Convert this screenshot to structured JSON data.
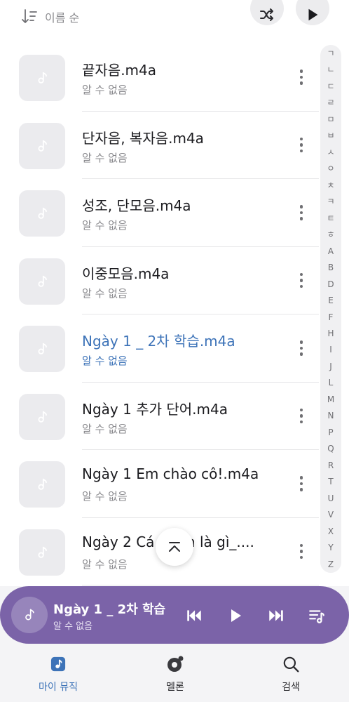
{
  "topbar": {
    "sort_label": "이름 순",
    "sort_icon": "sort-icon",
    "shuffle_icon": "shuffle-icon",
    "play_icon": "play-icon"
  },
  "songs": [
    {
      "title": "끝자음.m4a",
      "artist": "알 수 없음"
    },
    {
      "title": "단자음, 복자음.m4a",
      "artist": "알 수 없음"
    },
    {
      "title": "성조, 단모음.m4a",
      "artist": "알 수 없음"
    },
    {
      "title": "이중모음.m4a",
      "artist": "알 수 없음"
    },
    {
      "title": "Ngày 1 _ 2차 학습.m4a",
      "artist": "알 수 없음",
      "active": true
    },
    {
      "title": "Ngày 1 추가 단어.m4a",
      "artist": "알 수 없음"
    },
    {
      "title": "Ngày 1 Em chào cô!.m4a",
      "artist": "알 수 없음"
    },
    {
      "title": "Ngày 2 Cá    n tên là gì_....",
      "artist": "알 수 없음"
    }
  ],
  "index_letters": [
    "ㄱ",
    "ㄴ",
    "ㄷ",
    "ㄹ",
    "ㅁ",
    "ㅂ",
    "ㅅ",
    "ㅇ",
    "ㅊ",
    "ㅋ",
    "ㅌ",
    "ㅎ",
    "A",
    "B",
    "D",
    "E",
    "F",
    "H",
    "I",
    "J",
    "L",
    "M",
    "N",
    "P",
    "Q",
    "R",
    "T",
    "U",
    "V",
    "X",
    "Y",
    "Z"
  ],
  "mini_player": {
    "title": "Ngày 1 _ 2차 학습",
    "artist": "알 수 없음"
  },
  "bottom_nav": [
    {
      "label": "마이 뮤직",
      "icon": "music-note-icon",
      "active": true
    },
    {
      "label": "멜론",
      "icon": "melon-icon"
    },
    {
      "label": "검색",
      "icon": "search-icon"
    }
  ],
  "colors": {
    "accent": "#3d73b8",
    "player_bg": "#7b63a8"
  }
}
